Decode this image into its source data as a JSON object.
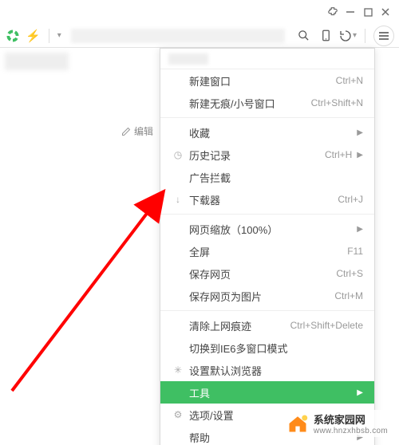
{
  "titlebar": {
    "ext_icon": "puzzle-icon",
    "min_icon": "minimize-icon",
    "max_icon": "maximize-icon",
    "close_icon": "close-icon"
  },
  "toolbar": {
    "logo_color": "#3fbf63",
    "bolt": "⚡",
    "dropdown": "▾",
    "search_icon": "search-icon",
    "phone_icon": "phone-icon",
    "undo_icon": "undo-icon",
    "menu_icon": "hamburger-icon"
  },
  "page": {
    "edit_label": "编辑"
  },
  "menu": {
    "items": [
      {
        "icon": "",
        "label": "新建窗口",
        "shortcut": "Ctrl+N",
        "sub": false
      },
      {
        "icon": "",
        "label": "新建无痕/小号窗口",
        "shortcut": "Ctrl+Shift+N",
        "sub": false
      },
      {
        "sep": true
      },
      {
        "icon": "",
        "label": "收藏",
        "shortcut": "",
        "sub": true
      },
      {
        "icon": "◷",
        "label": "历史记录",
        "shortcut": "Ctrl+H",
        "sub": true
      },
      {
        "icon": "",
        "label": "广告拦截",
        "shortcut": "",
        "sub": false
      },
      {
        "icon": "↓",
        "label": "下载器",
        "shortcut": "Ctrl+J",
        "sub": false
      },
      {
        "sep": true
      },
      {
        "icon": "",
        "label": "网页缩放（100%）",
        "shortcut": "",
        "sub": true
      },
      {
        "icon": "",
        "label": "全屏",
        "shortcut": "F11",
        "sub": false
      },
      {
        "icon": "",
        "label": "保存网页",
        "shortcut": "Ctrl+S",
        "sub": false
      },
      {
        "icon": "",
        "label": "保存网页为图片",
        "shortcut": "Ctrl+M",
        "sub": false
      },
      {
        "sep": true
      },
      {
        "icon": "",
        "label": "清除上网痕迹",
        "shortcut": "Ctrl+Shift+Delete",
        "sub": false
      },
      {
        "icon": "",
        "label": "切换到IE6多窗口模式",
        "shortcut": "",
        "sub": false
      },
      {
        "icon": "✳",
        "label": "设置默认浏览器",
        "shortcut": "",
        "sub": false
      },
      {
        "icon": "",
        "label": "工具",
        "shortcut": "",
        "sub": true,
        "highlight": true
      },
      {
        "icon": "⚙",
        "label": "选项/设置",
        "shortcut": "",
        "sub": false
      },
      {
        "icon": "",
        "label": "帮助",
        "shortcut": "",
        "sub": true
      }
    ]
  },
  "watermark": {
    "name": "系统家园网",
    "url": "www.hnzxhbsb.com"
  }
}
